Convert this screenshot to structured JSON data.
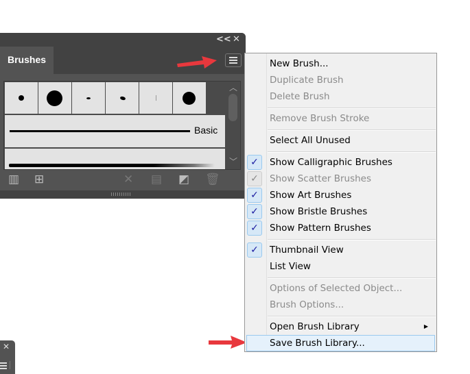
{
  "panel": {
    "title": "Brushes",
    "collapse": "<<",
    "close": "✕",
    "basic_label": "Basic"
  },
  "toolbar": {
    "icons": [
      "brush-libraries-icon",
      "cc-libraries-icon",
      "remove-brush-stroke-icon",
      "brush-options-icon",
      "new-brush-icon",
      "delete-brush-icon"
    ]
  },
  "menu": {
    "items": [
      {
        "label": "New Brush...",
        "enabled": true
      },
      {
        "label": "Duplicate Brush",
        "enabled": false
      },
      {
        "label": "Delete Brush",
        "enabled": false
      },
      {
        "label": "Remove Brush Stroke",
        "enabled": false
      },
      {
        "label": "Select All Unused",
        "enabled": true
      },
      {
        "label": "Show Calligraphic Brushes",
        "enabled": true,
        "checked": true
      },
      {
        "label": "Show Scatter Brushes",
        "enabled": false,
        "checked": true
      },
      {
        "label": "Show Art Brushes",
        "enabled": true,
        "checked": true
      },
      {
        "label": "Show Bristle Brushes",
        "enabled": true,
        "checked": true
      },
      {
        "label": "Show Pattern Brushes",
        "enabled": true,
        "checked": true
      },
      {
        "label": "Thumbnail View",
        "enabled": true,
        "checked": true
      },
      {
        "label": "List View",
        "enabled": true
      },
      {
        "label": "Options of Selected Object...",
        "enabled": false
      },
      {
        "label": "Brush Options...",
        "enabled": false
      },
      {
        "label": "Open Brush Library",
        "enabled": true,
        "submenu": true
      },
      {
        "label": "Save Brush Library...",
        "enabled": true,
        "highlighted": true
      }
    ],
    "check_glyph": "✓",
    "submenu_glyph": "▶"
  },
  "colors": {
    "annotation_arrow": "#e8383d",
    "panel_bg": "#535353",
    "menu_bg": "#f0f0f0"
  }
}
